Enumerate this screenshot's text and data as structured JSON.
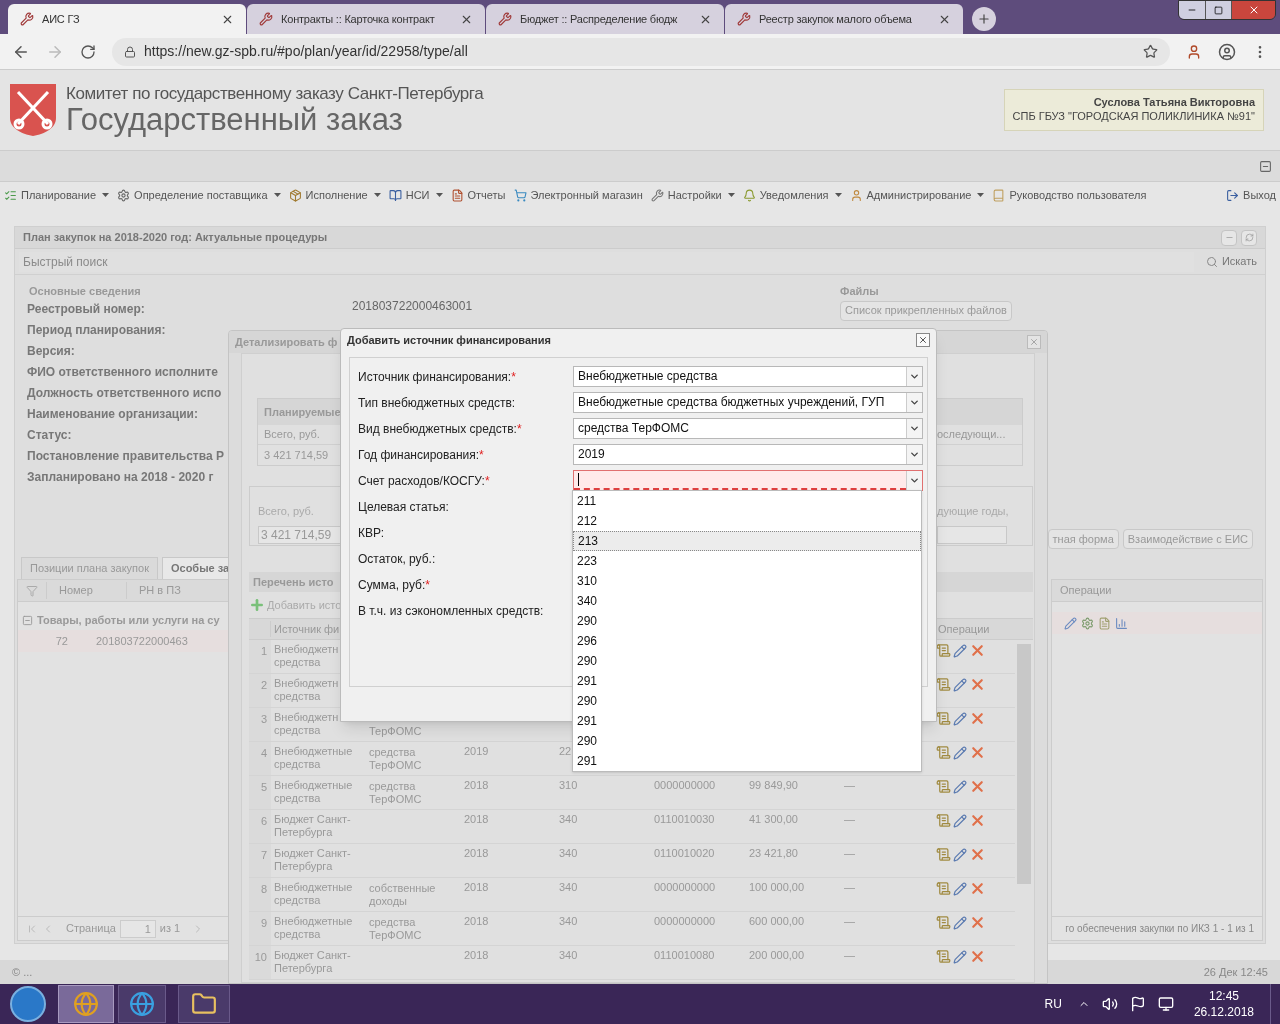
{
  "browser": {
    "tabs": [
      {
        "title": "АИС ГЗ",
        "selected": true
      },
      {
        "title": "Контракты :: Карточка контракт",
        "selected": false
      },
      {
        "title": "Бюджет :: Распределение бюдж",
        "selected": false
      },
      {
        "title": "Реестр закупок малого объема",
        "selected": false
      }
    ],
    "address": "https://new.gz-spb.ru/#po/plan/year/id/22958/type/all"
  },
  "header": {
    "org_line": "Комитет по государственному заказу Санкт-Петербурга",
    "title": "Государственный заказ",
    "user_name": "Суслова Татьяна Викторовна",
    "user_org": "СПБ ГБУЗ \"ГОРОДСКАЯ ПОЛИКЛИНИКА №91\""
  },
  "menu": [
    {
      "label": "Планирование",
      "kind": "list",
      "dropdown": true
    },
    {
      "label": "Определение поставщика",
      "kind": "gears",
      "dropdown": true
    },
    {
      "label": "Исполнение",
      "kind": "box",
      "dropdown": true
    },
    {
      "label": "НСИ",
      "kind": "book",
      "dropdown": true
    },
    {
      "label": "Отчеты",
      "kind": "report",
      "dropdown": false
    },
    {
      "label": "Электронный магазин",
      "kind": "cart",
      "dropdown": false
    },
    {
      "label": "Настройки",
      "kind": "wrench",
      "dropdown": true
    },
    {
      "label": "Уведомления",
      "kind": "bell",
      "dropdown": true
    },
    {
      "label": "Администрирование",
      "kind": "user",
      "dropdown": true
    },
    {
      "label": "Руководство пользователя",
      "kind": "manual",
      "dropdown": false
    }
  ],
  "exit_label": "Выход",
  "plan_panel": {
    "title": "План закупок на 2018-2020 год: Актуальные процедуры",
    "search_placeholder": "Быстрый поиск",
    "search_button": "Искать",
    "section_title": "Основные сведения",
    "fields": [
      {
        "label": "Реестровый номер:",
        "value": "201803722000463001"
      },
      {
        "label": "Период планирования:"
      },
      {
        "label": "Версия:"
      },
      {
        "label": "ФИО ответственного исполните"
      },
      {
        "label": "Должность ответственного испо"
      },
      {
        "label": "Наименование организации:"
      },
      {
        "label": "Статус:"
      },
      {
        "label": "Постановление правительства Р"
      },
      {
        "label": "Запланировано на 2018 - 2020 г"
      }
    ],
    "files_title": "Файлы",
    "files_button": "Список прикрепленных файлов",
    "buttons": [
      "тная форма",
      "Взаимодействие с ЕИС"
    ],
    "tabs": [
      {
        "label": "Позиции плана закупок",
        "selected": false
      },
      {
        "label": "Особые за",
        "selected": true
      }
    ],
    "left_grid": {
      "columns": [
        "Номер",
        "РН в ПЗ"
      ],
      "group": "Товары, работы или услуги на су",
      "rows": [
        {
          "number": "72",
          "rn": "201803722000463"
        }
      ],
      "pager": {
        "label": "Страница",
        "page": "1",
        "of": "из 1"
      }
    },
    "right_grid": {
      "column": "Операции",
      "pager_text": "го обеспечения закупки по ИКЗ 1 - 1 из 1"
    }
  },
  "detail_dialog": {
    "title": "Детализировать ф",
    "planned": {
      "title": "Планируемые",
      "total_label": "Всего, руб.",
      "next_label": "оследующи...",
      "total": "3 421 714,59"
    },
    "second": {
      "total_label": "Всего, руб.",
      "total": "3 421 714,59",
      "next_label": "дующие годы,"
    },
    "list_title": "Перечень исто",
    "add_button": "Добавить исто",
    "columns": {
      "source": "Источник фи",
      "operations": "Операции"
    },
    "rows": [
      {
        "n": "1",
        "source": "Внебюджетн средства"
      },
      {
        "n": "2",
        "source": "Внебюджетн средства"
      },
      {
        "n": "3",
        "source": "Внебюджетн средства",
        "type": "ТерФОМС"
      },
      {
        "n": "4",
        "source": "Внебюджетные средства",
        "type": "средства ТерФОМС",
        "year": "2019",
        "kosgu": "22"
      },
      {
        "n": "5",
        "source": "Внебюджетные средства",
        "type": "средства ТерФОМС",
        "year": "2018",
        "kosgu": "310",
        "target": "0000000000",
        "sum": "99 849,90",
        "saved": "—"
      },
      {
        "n": "6",
        "source": "Бюджет Санкт-Петербурга",
        "year": "2018",
        "kosgu": "340",
        "target": "0110010030",
        "sum": "41 300,00",
        "saved": "—"
      },
      {
        "n": "7",
        "source": "Бюджет Санкт-Петербурга",
        "year": "2018",
        "kosgu": "340",
        "target": "0110010020",
        "sum": "23 421,80",
        "saved": "—"
      },
      {
        "n": "8",
        "source": "Внебюджетные средства",
        "type": "собственные доходы",
        "year": "2018",
        "kosgu": "340",
        "target": "0000000000",
        "sum": "100 000,00",
        "saved": "—"
      },
      {
        "n": "9",
        "source": "Внебюджетные средства",
        "type": "средства ТерФОМС",
        "year": "2018",
        "kosgu": "340",
        "target": "0000000000",
        "sum": "600 000,00",
        "saved": "—"
      },
      {
        "n": "10",
        "source": "Бюджет Санкт-Петербурга",
        "year": "2018",
        "kosgu": "340",
        "target": "0110010080",
        "sum": "200 000,00",
        "saved": "—"
      }
    ]
  },
  "add_dialog": {
    "title": "Добавить источник финансирования",
    "required_mark": "*",
    "fields": [
      {
        "label": "Источник финансирования:",
        "required": true,
        "control": {
          "value": "Внебюджетные средства",
          "invalid": false,
          "focused": false
        }
      },
      {
        "label": "Тип внебюджетных средств:",
        "required": false,
        "control": {
          "value": "Внебюджетные средства бюджетных учреждений, ГУП",
          "invalid": false,
          "focused": false
        }
      },
      {
        "label": "Вид внебюджетных средств:",
        "required": true,
        "control": {
          "value": "средства ТерФОМС",
          "invalid": false,
          "focused": false
        }
      },
      {
        "label": "Год финансирования:",
        "required": true,
        "control": {
          "value": "2019",
          "invalid": false,
          "focused": false
        }
      },
      {
        "label": "Счет расходов/КОСГУ:",
        "required": true,
        "control": {
          "invalid": true,
          "focused": true
        }
      },
      {
        "label": "Целевая статья:",
        "required": false
      },
      {
        "label": "КВР:",
        "required": false
      },
      {
        "label": "Остаток, руб.:",
        "required": false
      },
      {
        "label": "Сумма, руб:",
        "required": true
      },
      {
        "label": "В т.ч. из сэкономленных средств:",
        "required": false
      }
    ],
    "options": [
      {
        "label": "211",
        "selected": false
      },
      {
        "label": "212",
        "selected": false
      },
      {
        "label": "213",
        "selected": true
      },
      {
        "label": "223",
        "selected": false
      },
      {
        "label": "310",
        "selected": false
      },
      {
        "label": "340",
        "selected": false
      },
      {
        "label": "290",
        "selected": false
      },
      {
        "label": "296",
        "selected": false
      },
      {
        "label": "290",
        "selected": false
      },
      {
        "label": "291",
        "selected": false
      },
      {
        "label": "290",
        "selected": false
      },
      {
        "label": "291",
        "selected": false
      },
      {
        "label": "290",
        "selected": false
      },
      {
        "label": "291",
        "selected": false
      }
    ]
  },
  "status_bar": {
    "left": "© ...",
    "right": "26 Дек 12:45"
  },
  "taskbar": {
    "language": "RU",
    "time": "12:45",
    "date": "26.12.2018"
  }
}
